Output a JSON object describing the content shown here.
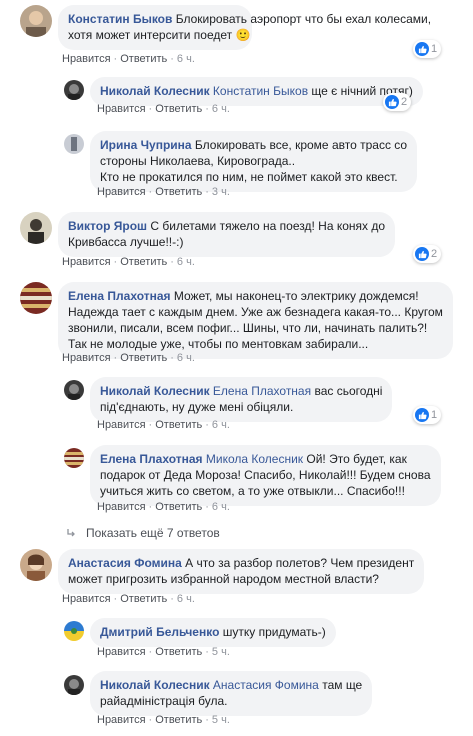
{
  "actions": {
    "like": "Нравится",
    "reply": "Ответить",
    "sep": "·"
  },
  "comments": [
    {
      "author": "Констатин Быков",
      "text_lines": [
        "Блокировать аэропорт что бы ехал колесами,",
        "хотя может интерсити поедет 🙂"
      ],
      "time": "6 ч.",
      "likes": "1"
    },
    {
      "author": "Николай Колесник",
      "mention": "Констатин Быков",
      "text": "ще є нічний потяг)",
      "time": "6 ч.",
      "likes": "2"
    },
    {
      "author": "Ирина Чуприна",
      "text_lines": [
        "Блокировать все, кроме авто трасс со",
        "стороны Николаева, Кировограда..",
        "Кто не прокатился по ним, не поймет какой это квест."
      ],
      "time": "3 ч."
    },
    {
      "author": "Виктор Ярош",
      "text_lines": [
        "С билетами тяжело на поезд! На конях до",
        "Кривбасса лучше!!-:)"
      ],
      "time": "6 ч.",
      "likes": "2"
    },
    {
      "author": "Елена Плахотная",
      "text_lines": [
        "Может, мы наконец-то электрику дождемся!",
        "Надежда тает с каждым днем. Уже аж безнадега какая-то... Кругом",
        "звонили, писали, всем пофиг... Шины, что ли, начинать палить?!",
        "Так не молодые уже, чтобы по ментовкам забирали..."
      ],
      "time": "6 ч."
    },
    {
      "author": "Николай Колесник",
      "mention": "Елена Плахотная",
      "text_lines": [
        "вас сьогодні",
        "під'єднають, ну дуже мені обіцяли."
      ],
      "time": "6 ч.",
      "likes": "1"
    },
    {
      "author": "Елена Плахотная",
      "mention": "Микола Колесник",
      "text_lines": [
        "Ой! Это будет, как",
        "подарок от Деда Мороза! Спасибо, Николай!!! Будем снова",
        "учиться жить со светом, а то уже отвыкли... Спасибо!!!"
      ],
      "time": "6 ч."
    },
    {
      "author": "Анастасия Фомина",
      "text_lines": [
        "А что за разбор полетов? Чем президент",
        "может пригрозить избранной народом местной власти?"
      ],
      "time": "6 ч."
    },
    {
      "author": "Дмитрий Бельченко",
      "text": "шутку придумать-)",
      "time": "5 ч."
    },
    {
      "author": "Николай Колесник",
      "mention": "Анастасия Фомина",
      "text_lines": [
        "там ще",
        "райадміністрація була."
      ],
      "time": "5 ч."
    }
  ],
  "more_replies_label": "Показать ещё 7 ответов",
  "colors": {
    "link": "#385898",
    "bubble": "#f2f3f5",
    "like": "#1877f2",
    "meta": "#90949c"
  }
}
